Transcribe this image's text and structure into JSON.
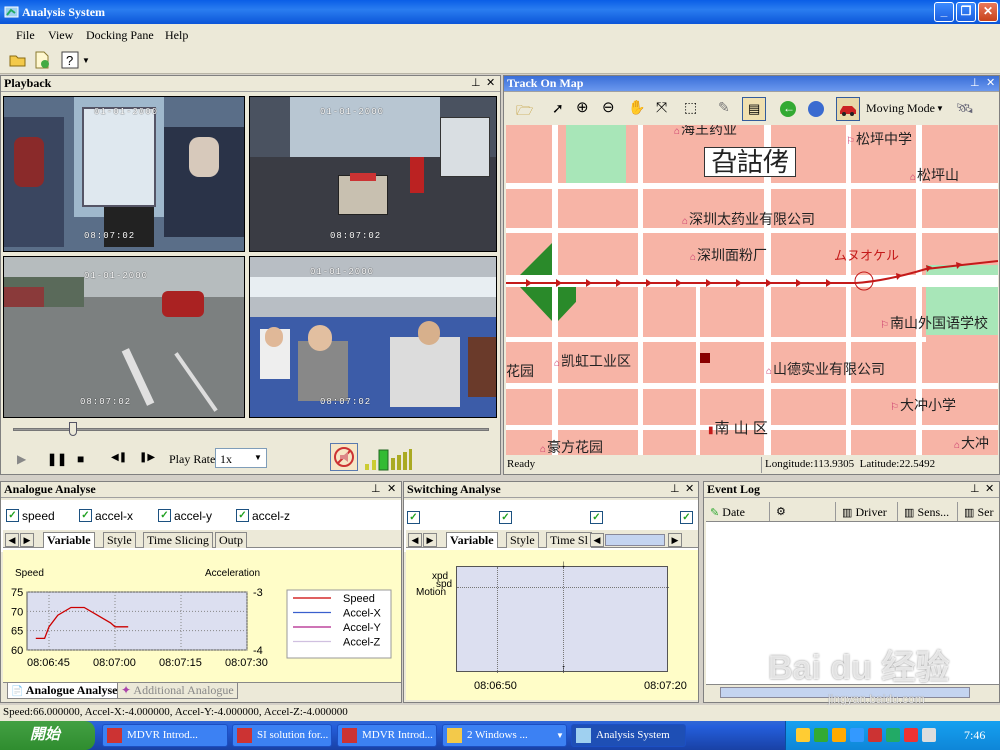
{
  "window": {
    "title": "Analysis System"
  },
  "menu": [
    "File",
    "View",
    "Docking Pane",
    "Help"
  ],
  "playback": {
    "title": "Playback",
    "play_rate_label": "Play Rate",
    "play_rate_value": "1x"
  },
  "map": {
    "title": "Track On Map",
    "mode": "Moving Mode",
    "status": "Ready",
    "longitude": "Longitude:113.9305",
    "latitude": "Latitude:22.5492",
    "labels": {
      "top": "海王药业",
      "songping_middle": "松坪中学",
      "stamp": "旮詁侤",
      "songping_shan": "松坪山",
      "shenzhen_pharma": "深圳太药业有限公司",
      "flour": "深圳面粉厂",
      "handwriting": "ムヌオケル",
      "nanshan_school": "南山外国语学校",
      "huayuan": "花园",
      "kaihong": "凯虹工业区",
      "shande": "山德实业有限公司",
      "dachong_school": "大冲小学",
      "nanshan_district": "南 山 区",
      "haofang": "豪方花园",
      "dachong": "大冲"
    }
  },
  "analogue": {
    "title": "Analogue Analyse",
    "checks": [
      "speed",
      "accel-x",
      "accel-y",
      "accel-z"
    ],
    "tabs": [
      "Variable",
      "Style",
      "Time Slicing",
      "Outp"
    ],
    "bottom_tabs": [
      "Analogue Analyse",
      "Additional Analogue"
    ]
  },
  "switching": {
    "title": "Switching Analyse",
    "tabs": [
      "Variable",
      "Style",
      "Time Sl"
    ],
    "ylabels": [
      "xpd",
      "spd",
      "Motion"
    ],
    "x_ticks": [
      "08:06:50",
      "08:07:20"
    ]
  },
  "eventlog": {
    "title": "Event Log",
    "columns": [
      "Date",
      "Driver",
      "Sens...",
      "Ser"
    ]
  },
  "status": "Speed:66.000000, Accel-X:-4.000000, Accel-Y:-4.000000, Accel-Z:-4.000000",
  "taskbar": {
    "start": "開始",
    "tasks": [
      "MDVR Introd...",
      "SI solution for...",
      "MDVR Introd...",
      "2 Windows ...",
      "Analysis System"
    ],
    "clock": "7:46"
  },
  "watermark": {
    "brand": "Bai du 经验",
    "url": "jingyan.baidu.com"
  },
  "chart_data": {
    "type": "line",
    "title": "",
    "xlabel": "",
    "ylabel": "Speed",
    "ylabel_right": "Acceleration",
    "x": [
      "08:06:42",
      "08:06:44",
      "08:06:45",
      "08:06:47",
      "08:06:50",
      "08:06:53",
      "08:06:56",
      "08:06:59",
      "08:07:00",
      "08:07:03"
    ],
    "x_ticks": [
      "08:06:45",
      "08:07:00",
      "08:07:15",
      "08:07:30"
    ],
    "ylim": [
      60,
      75
    ],
    "y_ticks": [
      60,
      65,
      70,
      75
    ],
    "y_right_ticks": [
      -3,
      -4
    ],
    "series": [
      {
        "name": "Speed",
        "color": "#cc0000",
        "values": [
          63,
          63,
          66,
          69,
          71,
          71,
          69,
          67,
          66,
          66
        ]
      },
      {
        "name": "Accel-X",
        "color": "#3a5fcd",
        "values": []
      },
      {
        "name": "Accel-Y",
        "color": "#b0208a",
        "values": []
      },
      {
        "name": "Accel-Z",
        "color": "#d0c0e0",
        "values": []
      }
    ],
    "legend": "right",
    "grid": true
  }
}
